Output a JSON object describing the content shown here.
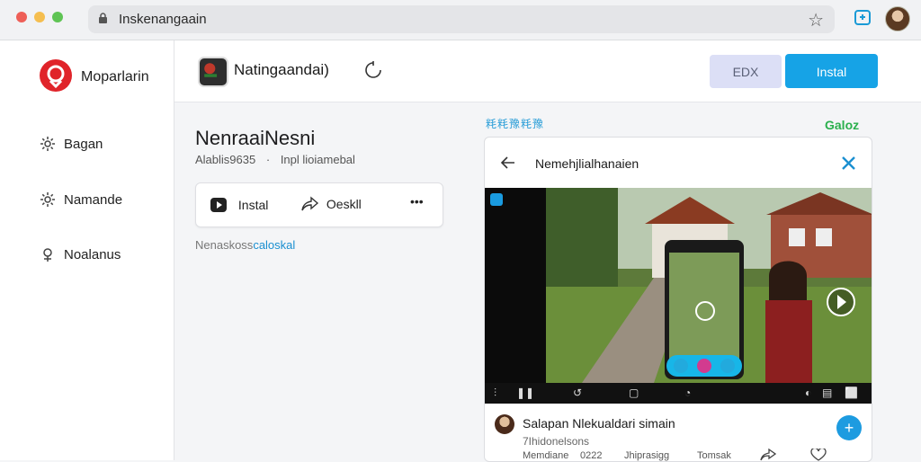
{
  "browser": {
    "url": "Inskenangaain",
    "traffic_lights": [
      "#ee5f57",
      "#f5be4f",
      "#5fc454"
    ]
  },
  "sidebar": {
    "brand": "Moparlarin",
    "items": [
      {
        "label": "Bagan",
        "icon": "gear-icon"
      },
      {
        "label": "Namande",
        "icon": "gear-icon"
      },
      {
        "label": "Noalanus",
        "icon": "pin-icon"
      }
    ]
  },
  "header": {
    "app_title": "Natingaandai)",
    "edx_label": "EDX",
    "install_label": "Instal"
  },
  "content": {
    "title": "NenraaiNesni",
    "meta_left": "Alablis9635",
    "meta_sep": "·",
    "meta_right": "Inpl lioiamebal",
    "actions": {
      "install": "Instal",
      "share": "Oeskll",
      "more": "•••"
    },
    "link_prefix": "Nenaskoss",
    "link_blue": "caloskal"
  },
  "panel": {
    "label": "粍粍豫粍豫",
    "corner": "Galoz",
    "card_title": "Nemehjlialhanaien",
    "comment": {
      "title": "Salapan Nlekualdari simain",
      "subtitle": "7Ihidonelsons",
      "meta1": "Memdiane",
      "meta2": "0222",
      "meta3": "Jhiprasigg",
      "meta4": "Tomsak"
    }
  },
  "colors": {
    "accent": "#16a3e6",
    "brand_red": "#e0242a",
    "edx_bg": "#dcdff6"
  }
}
